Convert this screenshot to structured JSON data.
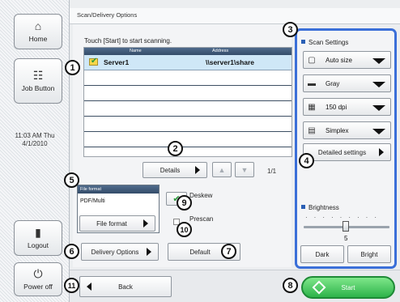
{
  "sidebar": {
    "home": "Home",
    "job_button": "Job Button",
    "clock_time": "11:03 AM Thu",
    "clock_date": "4/1/2010",
    "logout": "Logout",
    "power_off": "Power off"
  },
  "topbar": {
    "title": "Scan/Delivery Options"
  },
  "main": {
    "hint": "Touch [Start] to start scanning.",
    "dest_list": {
      "col_name": "Name",
      "col_address": "Address",
      "rows": [
        {
          "name": "Server1",
          "address": "\\\\server1\\share"
        }
      ]
    },
    "details_button": "Details",
    "page_indicator": "1/1",
    "file_format": {
      "header": "File format",
      "value": "PDF/Multi",
      "button": "File format"
    },
    "deskew": "Deskew",
    "prescan": "Prescan",
    "delivery_options": "Delivery Options",
    "default_button": "Default",
    "back": "Back",
    "start": "Start"
  },
  "scan_settings": {
    "title": "Scan Settings",
    "paper_size": "Auto size",
    "color": "Gray",
    "resolution": "150 dpi",
    "sides": "Simplex",
    "detailed": "Detailed settings",
    "brightness_title": "Brightness",
    "brightness_value": "5",
    "dark": "Dark",
    "bright": "Bright"
  },
  "callouts": [
    "1",
    "2",
    "3",
    "4",
    "5",
    "6",
    "7",
    "8",
    "9",
    "10",
    "11"
  ],
  "colors": {
    "accent": "#3b6fd8",
    "start": "#2db34a",
    "header": "#344c69"
  }
}
